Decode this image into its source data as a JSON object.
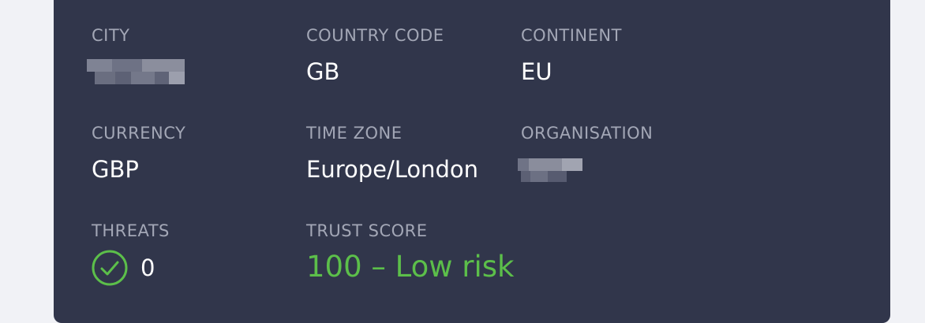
{
  "location": {
    "city": {
      "label": "CITY",
      "value_redacted": true
    },
    "country_code": {
      "label": "COUNTRY CODE",
      "value": "GB"
    },
    "continent": {
      "label": "CONTINENT",
      "value": "EU"
    },
    "currency": {
      "label": "CURRENCY",
      "value": "GBP"
    },
    "time_zone": {
      "label": "TIME ZONE",
      "value": "Europe/London"
    },
    "organisation": {
      "label": "ORGANISATION",
      "value_redacted": true
    },
    "threats": {
      "label": "THREATS",
      "value": "0",
      "icon": "check-circle-icon"
    },
    "trust_score": {
      "label": "TRUST SCORE",
      "value": "100 – Low risk"
    }
  },
  "colors": {
    "card_background": "#31364b",
    "page_background": "#f1f2f6",
    "label": "#a3a7b6",
    "value": "#ffffff",
    "success": "#5cbf4a"
  }
}
